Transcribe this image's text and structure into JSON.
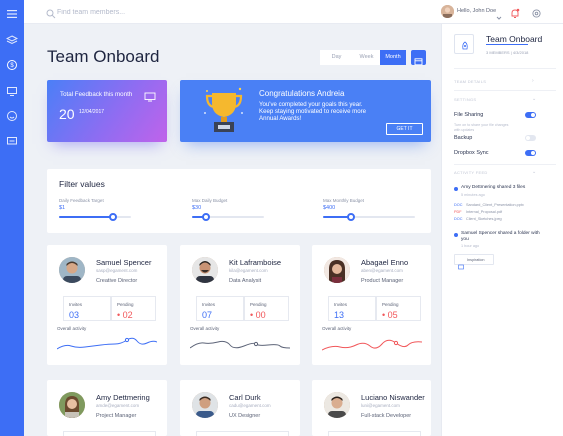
{
  "topbar": {
    "search_placeholder": "Find team members...",
    "greeting": "Hello, John Doe"
  },
  "page": {
    "title": "Team Onboard"
  },
  "range_tabs": [
    {
      "label": "Day",
      "active": false
    },
    {
      "label": "Week",
      "active": false
    },
    {
      "label": "Month",
      "active": true
    }
  ],
  "feedback_card": {
    "title": "Total Feedback this month",
    "day": "20",
    "date": "12/04/2017"
  },
  "congrats_card": {
    "title": "Congratulations Andreia",
    "body": "You've completed your goals this year. Keep staying motivated to receive more Annual Awards!",
    "button": "GET IT"
  },
  "filters": {
    "title": "Filter values",
    "items": [
      {
        "label": "Daily Feedback Target",
        "value": "$1",
        "level": 0.75
      },
      {
        "label": "Max Daily Budget",
        "value": "$30",
        "level": 0.2
      },
      {
        "label": "Max Monthly Budget",
        "value": "$400",
        "level": 0.3
      }
    ]
  },
  "members": [
    {
      "name": "Samuel Spencer",
      "email": "sasp@egament.com",
      "role": "Creative Director",
      "invites_label": "Invites",
      "invites": "03",
      "pending_label": "Pending",
      "pending": "02",
      "activity_label": "Overall activity",
      "color": "#3d6ef5"
    },
    {
      "name": "Kit Laframboise",
      "email": "kila@egament.com",
      "role": "Data Analysit",
      "invites_label": "Invites",
      "invites": "07",
      "pending_label": "Pending",
      "pending": "00",
      "activity_label": "Overall activity",
      "color": "#5d6478"
    },
    {
      "name": "Abagael Enno",
      "email": "aben@egament.com",
      "role": "Product Manager",
      "invites_label": "Invites",
      "invites": "13",
      "pending_label": "Pending",
      "pending": "05",
      "activity_label": "Overall activity",
      "color": "#f1575a"
    },
    {
      "name": "Amy Dettmering",
      "email": "amde@egament.com",
      "role": "Project Manager"
    },
    {
      "name": "Carl Durk",
      "email": "cadu@egament.com",
      "role": "UX Designer"
    },
    {
      "name": "Luciano Niswander",
      "email": "luni@egament.com",
      "role": "Full-stack Developer"
    }
  ],
  "panel": {
    "title": "Team Onboard",
    "subtitle": "3 MEMBERS  |  4/3/2018",
    "section1": "TEAM DETAILS",
    "section2": "SETTINGS",
    "section3": "ACTIVITY FEED",
    "file_sharing": "File Sharing",
    "file_sharing_desc": "Turn on to share your file changes with updates",
    "backup": "Backup",
    "dropbox": "Dropbox Sync",
    "feed1": "Amy Dettmering shared 3 files",
    "feed1_time": "5 minutes ago",
    "files": [
      {
        "ext": "DOC",
        "name": "Sandard_Client_Presentation.pptx"
      },
      {
        "ext": "PDF",
        "name": "Internal_Proposal.pdf"
      },
      {
        "ext": "DOC",
        "name": "Client_Sketches.jpeg"
      }
    ],
    "feed2": "Samuel Spencer shared a folder with you",
    "feed2_time": "1 hour ago",
    "folder": "Inspiration"
  }
}
